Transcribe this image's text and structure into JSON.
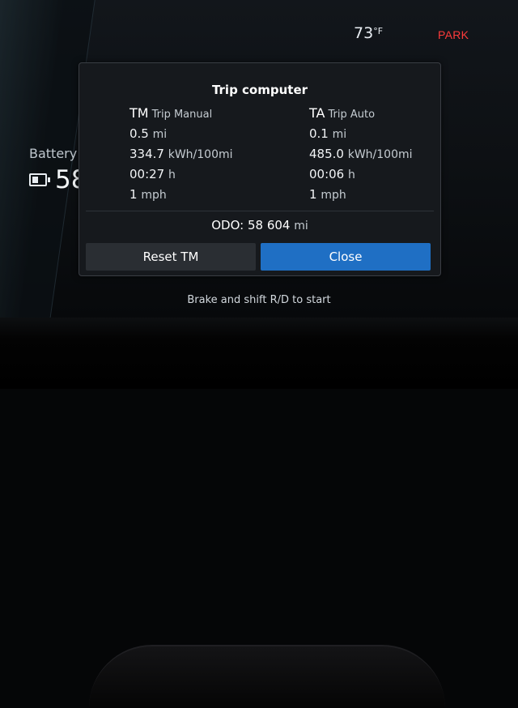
{
  "status": {
    "temperature_value": "73",
    "temperature_unit": "°F",
    "gear": "PARK"
  },
  "background": {
    "battery_label": "Battery",
    "battery_value_partial": "58"
  },
  "dialog": {
    "title": "Trip computer",
    "tm": {
      "abbr": "TM",
      "full": "Trip Manual",
      "distance_value": "0.5",
      "distance_unit": "mi",
      "consumption_value": "334.7",
      "consumption_unit": "kWh/100mi",
      "time_value": "00:27",
      "time_unit": "h",
      "speed_value": "1",
      "speed_unit": "mph"
    },
    "ta": {
      "abbr": "TA",
      "full": "Trip Auto",
      "distance_value": "0.1",
      "distance_unit": "mi",
      "consumption_value": "485.0",
      "consumption_unit": "kWh/100mi",
      "time_value": "00:06",
      "time_unit": "h",
      "speed_value": "1",
      "speed_unit": "mph"
    },
    "odo": {
      "label": "ODO:",
      "value": "58 604",
      "unit": "mi"
    },
    "buttons": {
      "reset_label": "Reset TM",
      "close_label": "Close"
    }
  },
  "hint": "Brake and shift R/D to start",
  "colors": {
    "accent": "#1f6fc4",
    "gear_park": "#ff3b3b",
    "dialog_bg": "#16191d"
  }
}
